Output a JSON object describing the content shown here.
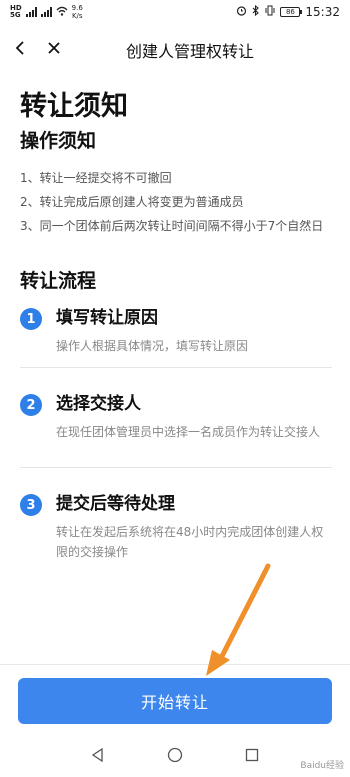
{
  "status_bar": {
    "network_hd": "HD",
    "network_gen": "5G",
    "speed_value": "9.6",
    "speed_unit": "K/s",
    "battery": "86",
    "time": "15:32"
  },
  "navbar": {
    "title": "创建人管理权转让"
  },
  "page_title": "转让须知",
  "notice": {
    "title": "操作须知",
    "items": [
      "1、转让一经提交将不可撤回",
      "2、转让完成后原创建人将变更为普通成员",
      "3、同一个团体前后两次转让时间间隔不得小于7个自然日"
    ]
  },
  "process": {
    "title": "转让流程",
    "steps": [
      {
        "num": "1",
        "title": "填写转让原因",
        "desc": "操作人根据具体情况，填写转让原因"
      },
      {
        "num": "2",
        "title": "选择交接人",
        "desc": "在现任团体管理员中选择一名成员作为转让交接人"
      },
      {
        "num": "3",
        "title": "提交后等待处理",
        "desc": "转让在发起后系统将在48小时内完成团体创建人权限的交接操作"
      }
    ]
  },
  "start_button": "开始转让",
  "watermark": "Baidu经验",
  "colors": {
    "accent": "#3d86ee",
    "badge": "#2f7fe8",
    "arrow": "#f0902a"
  }
}
